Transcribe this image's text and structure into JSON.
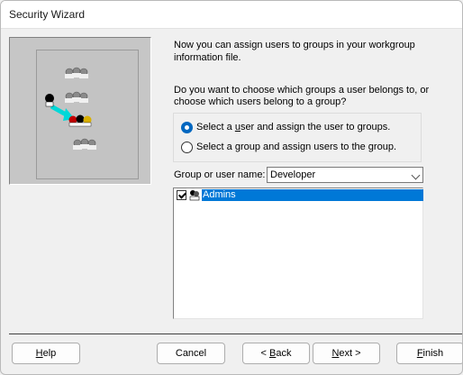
{
  "window": {
    "title": "Security Wizard"
  },
  "intro": {
    "text": "Now you can assign users to groups in your workgroup information file."
  },
  "question": {
    "text": "Do you want to choose which groups a user belongs to, or choose which users belong to a group?"
  },
  "options": {
    "selected": "user",
    "user": {
      "pre": "Select a ",
      "accel": "u",
      "post": "ser and assign the user to groups."
    },
    "group": {
      "pre": "Select a ",
      "accel": "g",
      "post": "roup and assign users to the group."
    }
  },
  "group_field": {
    "label": "Group or user name:",
    "value": "Developer"
  },
  "list": {
    "items": [
      {
        "label": "Admins",
        "checked": true,
        "selected": true,
        "icon": "group-icon"
      }
    ]
  },
  "buttons": {
    "help": {
      "accel": "H",
      "rest": "elp"
    },
    "cancel": {
      "label": "Cancel"
    },
    "back": {
      "pre": "< ",
      "accel": "B",
      "rest": "ack"
    },
    "next": {
      "accel": "N",
      "rest": "ext >"
    },
    "finish": {
      "accel": "F",
      "rest": "inish"
    }
  },
  "colors": {
    "accent": "#0067c0",
    "selection": "#0078d7"
  }
}
